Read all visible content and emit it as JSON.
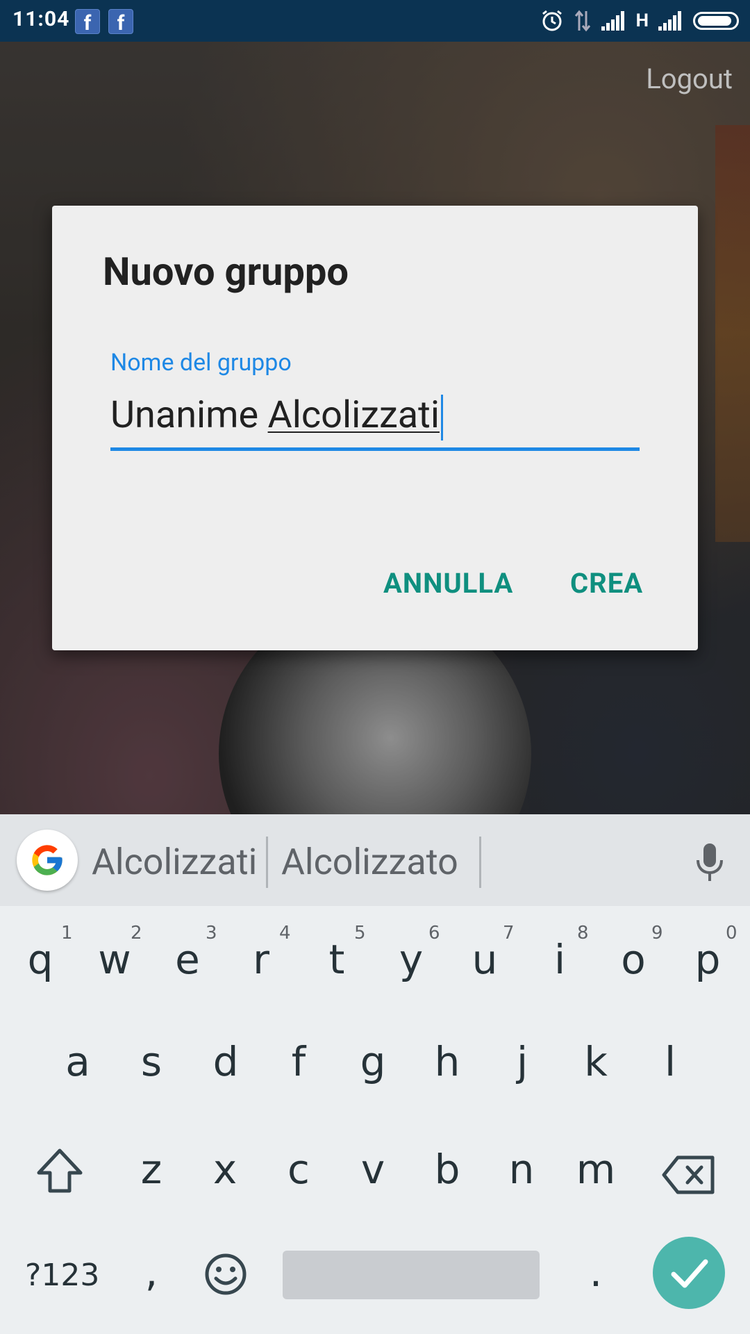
{
  "status_bar": {
    "time": "11:04",
    "network_label": "H"
  },
  "app": {
    "logout_label": "Logout"
  },
  "dialog": {
    "title": "Nuovo gruppo",
    "field_label": "Nome del gruppo",
    "field_value_plain": "Unanime ",
    "field_value_composing": "Alcolizzati",
    "cancel_label": "ANNULLA",
    "create_label": "CREA"
  },
  "keyboard": {
    "suggestions": [
      "Alcolizzati",
      "Alcolizzato"
    ],
    "row1": [
      "q",
      "w",
      "e",
      "r",
      "t",
      "y",
      "u",
      "i",
      "o",
      "p"
    ],
    "row1_hints": [
      "1",
      "2",
      "3",
      "4",
      "5",
      "6",
      "7",
      "8",
      "9",
      "0"
    ],
    "row2": [
      "a",
      "s",
      "d",
      "f",
      "g",
      "h",
      "j",
      "k",
      "l"
    ],
    "row3": [
      "z",
      "x",
      "c",
      "v",
      "b",
      "n",
      "m"
    ],
    "symbols_label": "?123",
    "comma": ",",
    "period": "."
  },
  "colors": {
    "accent": "#1e88e5",
    "dialog_button": "#0f8f7f",
    "done_button": "#4db6ac",
    "status_bar": "#0b3352"
  }
}
